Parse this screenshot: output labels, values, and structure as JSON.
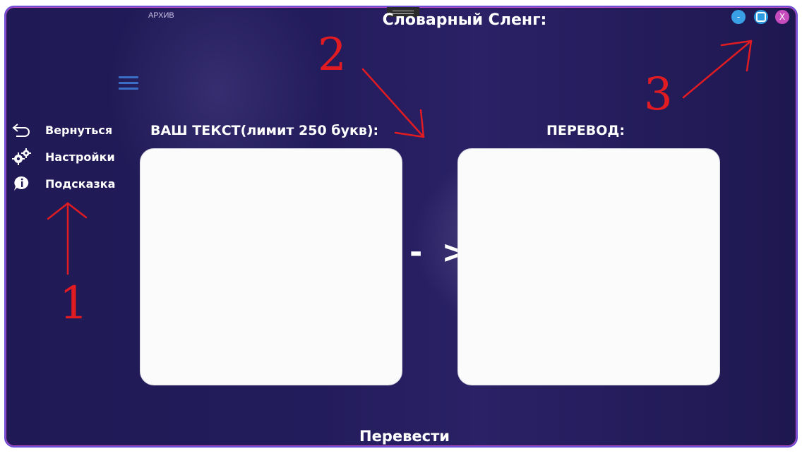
{
  "window": {
    "app_label": "АРХИВ",
    "title": "Словарный Сленг:",
    "minimize_label": "-",
    "close_label": "X"
  },
  "sidebar": {
    "items": [
      {
        "label": "Вернуться",
        "icon": "back-arrow-icon"
      },
      {
        "label": "Настройки",
        "icon": "gears-icon"
      },
      {
        "label": "Подсказка",
        "icon": "info-bubble-icon"
      }
    ]
  },
  "main": {
    "input_label": "ВАШ ТЕКСТ(лимит 250 букв):",
    "input_value": "",
    "arrow_text": "- >",
    "output_label": "ПЕРЕВОД:",
    "output_value": "",
    "translate_label": "Перевести"
  },
  "annotations": {
    "marker_1": "1",
    "marker_2": "2",
    "marker_3": "3",
    "color": "#e11b22"
  },
  "colors": {
    "window_bg": "#221b5a",
    "window_border": "#6c4fd6",
    "minimize": "#3aa0e6",
    "maximize": "#2e9be0",
    "close": "#c64bbd"
  }
}
